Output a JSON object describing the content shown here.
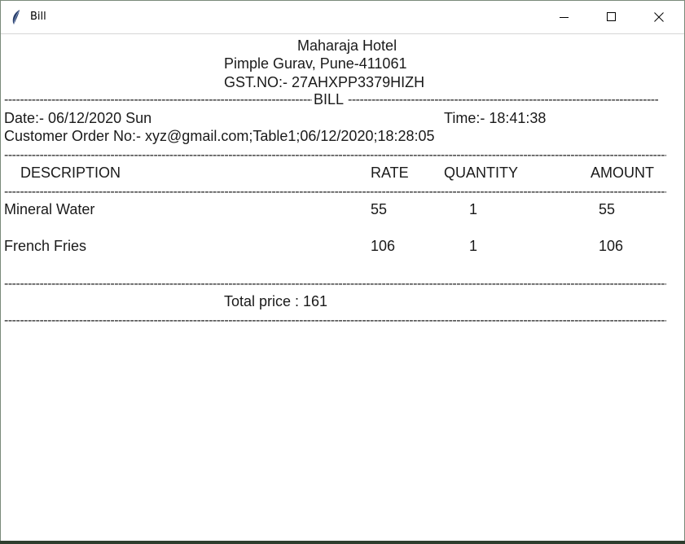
{
  "window": {
    "title": "Bill",
    "controls": {
      "minimize": "minimize",
      "maximize": "maximize",
      "close": "close"
    }
  },
  "header": {
    "hotel_name": "Maharaja Hotel",
    "address": "Pimple Gurav, Pune-411061",
    "gst": "GST.NO:- 27AHXPP3379HIZH",
    "bill_label": "BILL"
  },
  "info": {
    "date": "Date:- 06/12/2020 Sun",
    "time": "Time:- 18:41:38",
    "order_no": "Customer Order No:- xyz@gmail.com;Table1;06/12/2020;18:28:05"
  },
  "table": {
    "columns": [
      "DESCRIPTION",
      "RATE",
      "QUANTITY",
      "AMOUNT"
    ],
    "rows": [
      {
        "description": "Mineral Water",
        "rate": "55",
        "quantity": "1",
        "amount": "55"
      },
      {
        "description": "French Fries",
        "rate": "106",
        "quantity": "1",
        "amount": "106"
      }
    ]
  },
  "total": "Total price : 161",
  "separator": "--------------------------------------------------------------------------------------------------------------------------------------------------------------------------------------"
}
